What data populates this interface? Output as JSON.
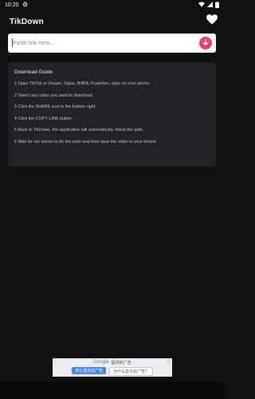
{
  "status_bar": {
    "time": "10:20",
    "icons": [
      "settings-icon",
      "wifi-icon",
      "cellular-icon",
      "battery-icon"
    ]
  },
  "app": {
    "title": "TikDown",
    "favorite_icon": "heart-icon"
  },
  "search": {
    "placeholder": "Paste link here...",
    "value": "",
    "button_icon": "download-arrow-icon"
  },
  "guide": {
    "title": "Download Guide",
    "steps": [
      "1 Open TikTok or Douyin, Xigua, BiliBili, Kuaishou, apps on your phone.",
      "2 Select any video you want to download.",
      "3 Click the SHARE icon in the bottom right.",
      "4 Click the COPY LINK button.",
      "5 Back to TikDown, the application will automatically check the path.",
      "6 Wait for our server to do the work and then save the video to your device."
    ]
  },
  "ad": {
    "brand": "Google",
    "title_suffix": "提供的广告",
    "stop_label": "停止显示此广告",
    "why_label": "为什么显示此广告？",
    "close_glyph": "←",
    "info_glyph": "ⓘ"
  },
  "colors": {
    "accent": "#f23e64",
    "background": "#111114",
    "card": "#222228"
  }
}
